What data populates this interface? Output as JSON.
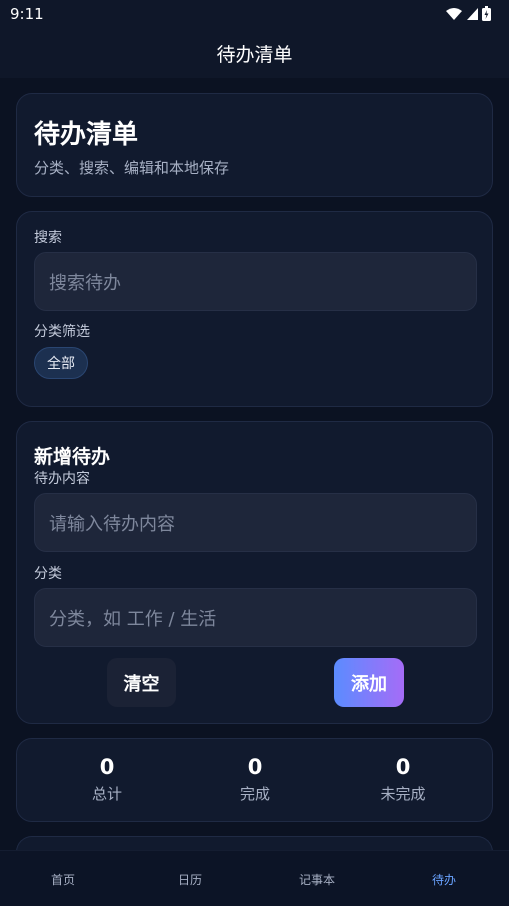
{
  "status_bar": {
    "time": "9:11"
  },
  "app_bar": {
    "title": "待办清单"
  },
  "hero": {
    "title": "待办清单",
    "subtitle": "分类、搜索、编辑和本地保存"
  },
  "search": {
    "label": "搜索",
    "placeholder": "搜索待办",
    "filter_label": "分类筛选",
    "filter_chip": "全部"
  },
  "new_todo": {
    "title": "新增待办",
    "content_label": "待办内容",
    "content_placeholder": "请输入待办内容",
    "category_label": "分类",
    "category_placeholder": "分类，如 工作 / 生活",
    "clear_label": "清空",
    "add_label": "添加"
  },
  "stats": [
    {
      "value": "0",
      "label": "总计"
    },
    {
      "value": "0",
      "label": "完成"
    },
    {
      "value": "0",
      "label": "未完成"
    }
  ],
  "bottom_nav": [
    {
      "label": "首页",
      "active": false
    },
    {
      "label": "日历",
      "active": false
    },
    {
      "label": "记事本",
      "active": false
    },
    {
      "label": "待办",
      "active": true
    }
  ],
  "colors": {
    "accent": "#6aa3ff",
    "gradient_start": "#5b8cff",
    "gradient_end": "#a56cf7"
  }
}
